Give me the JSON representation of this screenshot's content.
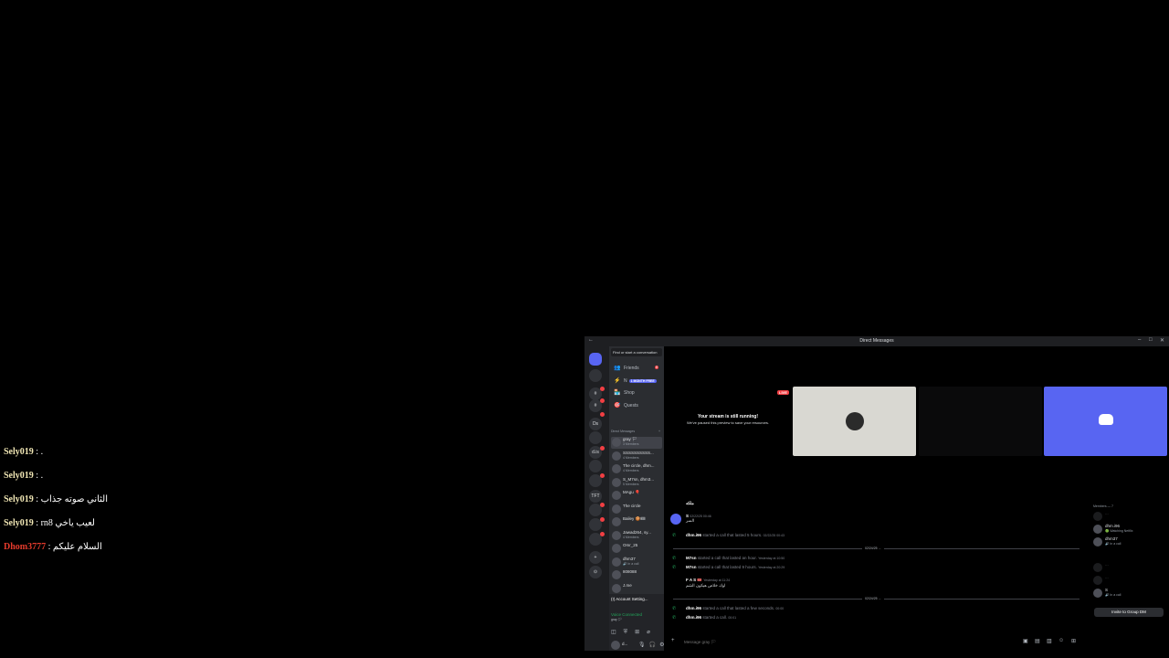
{
  "chat_overlay": [
    {
      "user": "Sely019",
      "sep": " : ",
      "text": "."
    },
    {
      "user": "Sely019",
      "sep": " : ",
      "text": "."
    },
    {
      "user": "Sely019",
      "sep": " : ",
      "text": "الثاني صوته جذاب"
    },
    {
      "user": "Sely019",
      "sep": " : ",
      "text": "rn8 لعيب ياخي"
    },
    {
      "user": "Dhom3777",
      "sep": " : ",
      "text": "السلام عليكم"
    }
  ],
  "window": {
    "title": "Direct Messages",
    "back": "←",
    "minimize": "–",
    "maximize": "□",
    "close": "✕"
  },
  "servers": [
    {
      "label": ""
    },
    {
      "label": ""
    },
    {
      "label": "#"
    },
    {
      "label": "#"
    },
    {
      "label": "Ds"
    },
    {
      "label": ""
    },
    {
      "label": "d.is"
    },
    {
      "label": ""
    },
    {
      "label": ""
    },
    {
      "label": "TFT"
    },
    {
      "label": ""
    },
    {
      "label": ""
    },
    {
      "label": ""
    },
    {
      "label": "+"
    },
    {
      "label": "⊙"
    }
  ],
  "sidebar": {
    "search_placeholder": "Find or start a conversation",
    "nav": [
      {
        "icon": "👥",
        "label": "Friends",
        "badge": "8"
      },
      {
        "icon": "⚡",
        "label": "N",
        "pill": "1 MONTH FREE"
      },
      {
        "icon": "🏪",
        "label": "Shop"
      },
      {
        "icon": "🎯",
        "label": "Quests"
      }
    ],
    "dm_header": "Direct Messages",
    "dm_add": "+",
    "dms": [
      {
        "name": "gray 🏳",
        "sub": "3 Members",
        "selected": true
      },
      {
        "name": "SSSSSSSSSS...",
        "sub": "4 Members"
      },
      {
        "name": "The circle, dhm...",
        "sub": "4 Members"
      },
      {
        "name": "S_M7sn, dhm3...",
        "sub": "5 Members"
      },
      {
        "name": "MAgu 🎈",
        "sub": ""
      },
      {
        "name": "The circle",
        "sub": ""
      },
      {
        "name": "Bailey 🍪🎟",
        "sub": ""
      },
      {
        "name": "Jawad264, sy...",
        "sub": "4 Members"
      },
      {
        "name": "Omr_25",
        "sub": ""
      },
      {
        "name": "dhm37",
        "sub": "🔊 In a call"
      },
      {
        "name": "808088",
        "sub": ""
      },
      {
        "name": "J.me",
        "sub": ""
      }
    ],
    "account_banner": "(!) Account Setting...",
    "voice_status": "Voice Connected",
    "voice_channel": "gray 🏳",
    "user_name": "d...",
    "user_status": "..."
  },
  "stream": {
    "live_badge": "LIVE",
    "title": "Your stream is still running!",
    "subtitle": "We've paused this preview to save your resources."
  },
  "messages": [
    {
      "kind": "text",
      "author": "ملكه",
      "meta": "",
      "text": ""
    },
    {
      "kind": "text",
      "author": "S",
      "meta": "02/22/25 00:46",
      "text": "السر"
    },
    {
      "kind": "call",
      "author": "dhm.i96",
      "text": "started a call that lasted 5 hours.",
      "meta": "02/22/25 00:43"
    },
    {
      "kind": "sep",
      "text": "02/24/25 ..."
    },
    {
      "kind": "call",
      "author": "M7sn",
      "text": "started a call that lasted an hour.",
      "meta": "Yesterday at 10:50"
    },
    {
      "kind": "call",
      "author": "M7sn",
      "text": "started a call that lasted 9 hours.",
      "meta": "Yesterday at 20:29"
    },
    {
      "kind": "text",
      "author": "F A S 🎟️",
      "meta": "Yesterday at 11:24",
      "text": "اوك خلاص هيكون الشم"
    },
    {
      "kind": "sep",
      "text": "02/24/25 ..."
    },
    {
      "kind": "call",
      "author": "dhm.i96",
      "text": "started a call that lasted a few seconds.",
      "meta": "00:00"
    },
    {
      "kind": "call",
      "author": "dhm.i96",
      "text": "started a call.",
      "meta": "00:01"
    }
  ],
  "composer": {
    "placeholder": "Message gray 🏳"
  },
  "members": {
    "header": "Members — 7",
    "list": [
      {
        "name": "...",
        "status": "",
        "dim": true
      },
      {
        "name": "dhm.i96",
        "status": "🟢 Watching Netflix",
        "dim": false
      },
      {
        "name": "dhm37",
        "status": "🔊 In a call",
        "dim": false
      },
      {
        "name": "...",
        "status": "",
        "dim": true
      },
      {
        "name": "...",
        "status": "",
        "dim": true
      },
      {
        "name": "S",
        "status": "🔊 In a call",
        "dim": false
      }
    ],
    "invite_label": "Invite to Group DM"
  }
}
